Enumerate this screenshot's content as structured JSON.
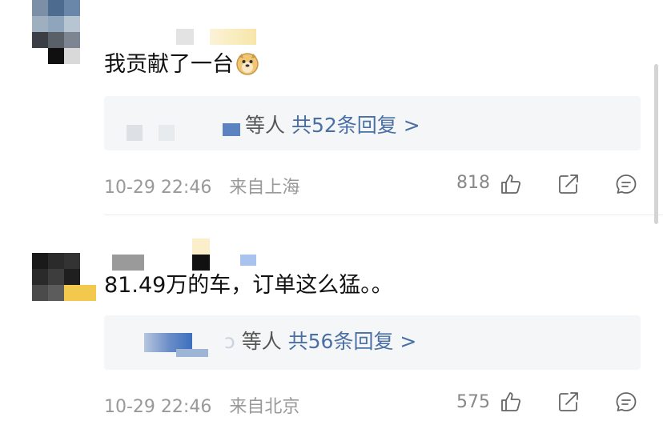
{
  "comments": [
    {
      "text": "我贡献了一台",
      "reply_users_suffix": "等人",
      "reply_count": "共52条回复 >",
      "date": "10-29 22:46",
      "location": "来自上海",
      "likes": "818"
    },
    {
      "text": "81.49万的车，订单这么猛。。",
      "reply_users_suffix": "等人",
      "reply_count": "共56条回复 >",
      "date": "10-29 22:46",
      "location": "来自北京",
      "likes": "575"
    }
  ],
  "icons": {
    "emoji": "doge-emoji-icon",
    "like": "thumbs-up-icon",
    "share": "share-icon",
    "comment": "comment-icon"
  },
  "colors": {
    "reply_link": "#4a6fa5",
    "meta_text": "#999999",
    "reply_bg": "#f5f6f7"
  }
}
